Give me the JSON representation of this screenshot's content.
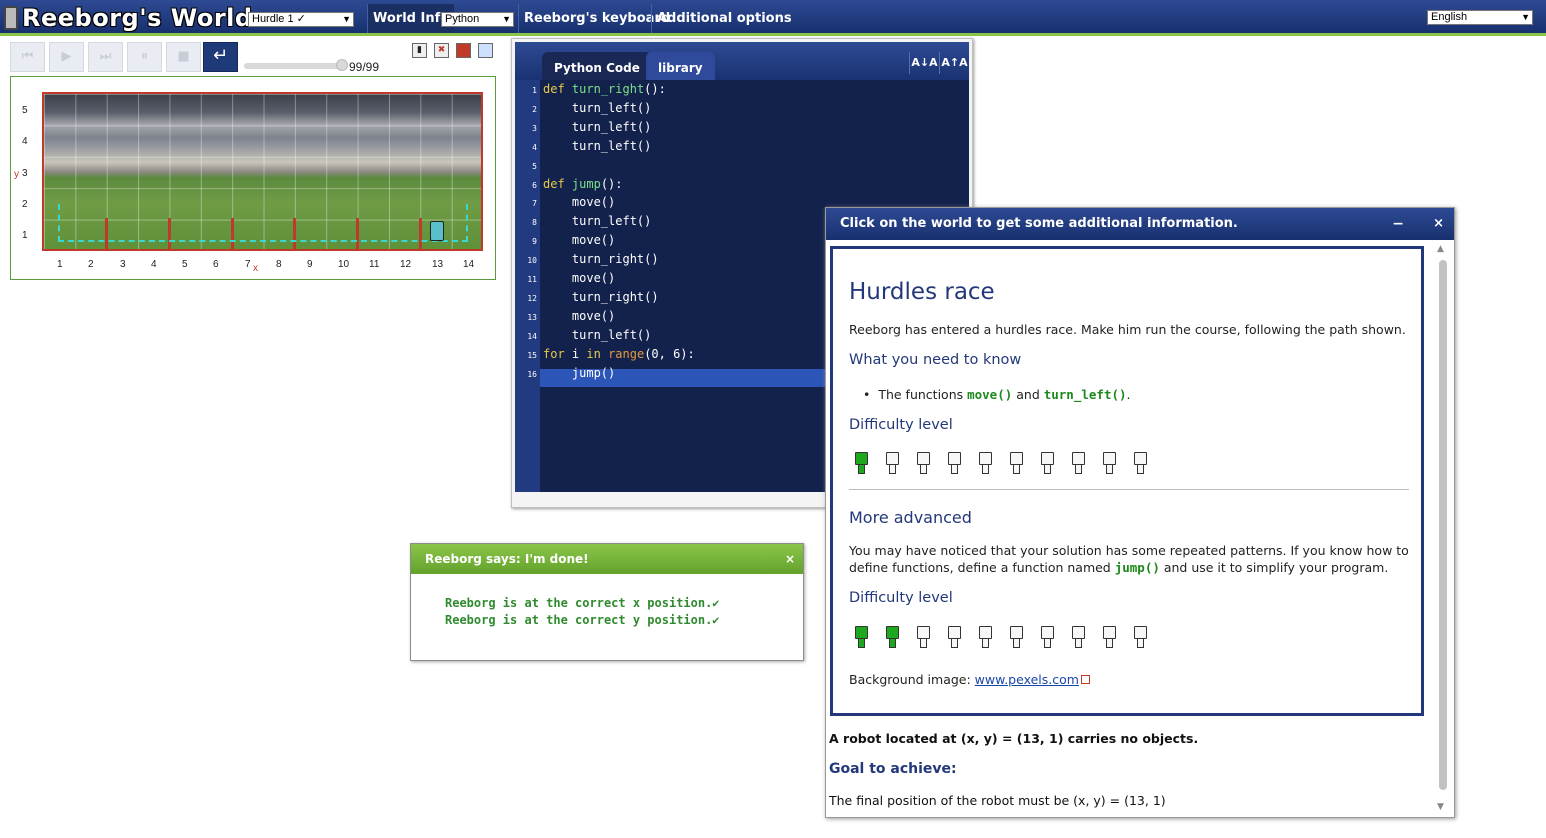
{
  "app": {
    "title": "Reeborg's World"
  },
  "topbar": {
    "world_select": "Hurdle 1 ✓ ",
    "language_mode": "Python",
    "tabs": [
      "World Info",
      "Reeborg's keyboard",
      "Additional options"
    ],
    "ui_language": "English"
  },
  "controls": {
    "reload_glyph": "↵",
    "step_counter": "99/99",
    "step_progress": 1.0
  },
  "world": {
    "y_ticks": [
      "5",
      "4",
      "3",
      "2",
      "1"
    ],
    "x_ticks": [
      "1",
      "2",
      "3",
      "4",
      "5",
      "6",
      "7",
      "8",
      "9",
      "10",
      "11",
      "12",
      "13",
      "14"
    ],
    "x_axis_letter": "x",
    "y_axis_letter": "y",
    "robot_position": [
      13,
      1
    ]
  },
  "editor": {
    "tabs": [
      "Python Code",
      "library"
    ],
    "font_buttons": [
      "A↓A",
      "A↑A"
    ],
    "lines": [
      "def turn_right():",
      "    turn_left()",
      "    turn_left()",
      "    turn_left()",
      "",
      "def jump():",
      "    move()",
      "    turn_left()",
      "    move()",
      "    turn_right()",
      "    move()",
      "    turn_right()",
      "    move()",
      "    turn_left()",
      "for i in range(0, 6):",
      "    jump()"
    ],
    "highlighted_line": 14
  },
  "done_dialog": {
    "title": "Reeborg says: I'm done!",
    "close": "×",
    "messages": [
      "Reeborg is at the correct x position.✔",
      "Reeborg is at the correct y position.✔"
    ]
  },
  "info_dialog": {
    "title": "Click on the world to get some additional information.",
    "minimize": "−",
    "close": "×",
    "heading": "Hurdles race",
    "intro": "Reeborg has entered a hurdles race. Make him run the course, following the path shown.",
    "know_heading": "What you need to know",
    "know_prefix": "The functions ",
    "know_fn1": "move()",
    "know_mid": " and ",
    "know_fn2": "turn_left()",
    "know_suffix": ".",
    "difficulty_heading": "Difficulty level",
    "difficulty_1": 1,
    "difficulty_max": 10,
    "advanced_heading": "More advanced",
    "advanced_text_1": "You may have noticed that your solution has some repeated patterns. If you know how to",
    "advanced_text_2a": "define functions, define a function named ",
    "advanced_fn": "jump()",
    "advanced_text_2b": " and use it to simplify your program.",
    "difficulty_2": 2,
    "background_label": "Background image: ",
    "background_link": "www.pexels.com",
    "robot_status": "A robot located at (x, y) = (13, 1) carries no objects.",
    "goal_heading": "Goal to achieve:",
    "goal_text": "The final position of the robot must be (x, y) = (13, 1)"
  }
}
